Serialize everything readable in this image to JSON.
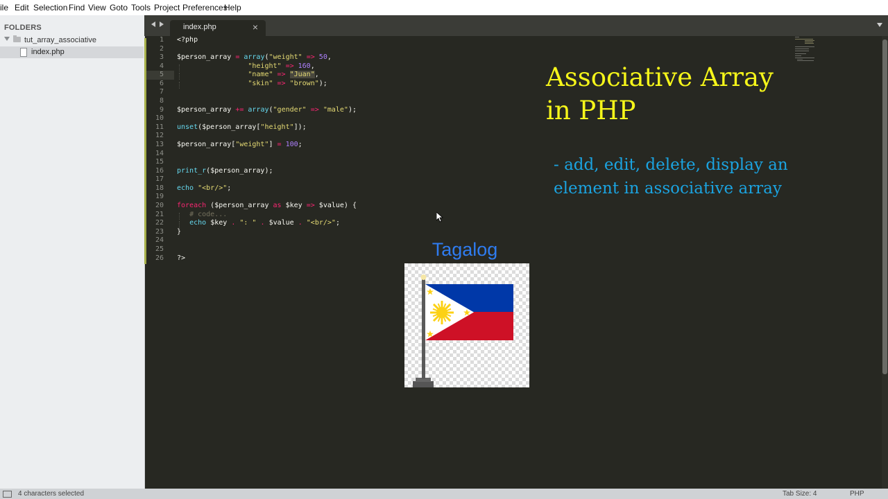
{
  "menubar": {
    "items": [
      "ile",
      "Edit",
      "Selection",
      "Find",
      "View",
      "Goto",
      "Tools",
      "Project",
      "Preferences",
      "Help"
    ]
  },
  "sidebar": {
    "heading": "FOLDERS",
    "folder": "tut_array_associative",
    "file": "index.php"
  },
  "tab": {
    "label": "index.php",
    "close": "×"
  },
  "editor": {
    "line_numbers": [
      "1",
      "2",
      "3",
      "4",
      "5",
      "6",
      "7",
      "8",
      "9",
      "10",
      "11",
      "12",
      "13",
      "14",
      "15",
      "16",
      "17",
      "18",
      "19",
      "20",
      "21",
      "22",
      "23",
      "24",
      "25",
      "26"
    ],
    "code": {
      "l1": "<?php",
      "l3_var": "$person_array",
      "l3_op": "=",
      "l3_fn": "array",
      "l3_key": "\"weight\"",
      "l3_arrow": "=>",
      "l3_val": "50",
      "l4_key": "\"height\"",
      "l4_val": "160",
      "l5_key": "\"name\"",
      "l5_val": "\"Juan\"",
      "l6_key": "\"skin\"",
      "l6_val": "\"brown\"",
      "l9_var": "$person_array",
      "l9_op": "+=",
      "l9_fn": "array",
      "l9_key": "\"gender\"",
      "l9_val": "\"male\"",
      "l11_fn": "unset",
      "l11_var": "$person_array",
      "l11_key": "\"height\"",
      "l13_var": "$person_array",
      "l13_key": "\"weight\"",
      "l13_op": "=",
      "l13_val": "100",
      "l16_fn": "print_r",
      "l16_var": "$person_array",
      "l18_kw": "echo",
      "l18_str": "\"<br/>\"",
      "l20_kw": "foreach",
      "l20_var": "$person_array",
      "l20_as": "as",
      "l20_key": "$key",
      "l20_arrow": "=>",
      "l20_value": "$value",
      "l21_cmt": "# code...",
      "l22_kw": "echo",
      "l22_key": "$key",
      "l22_dot": ".",
      "l22_sep": "\": \"",
      "l22_value": "$value",
      "l22_br": "\"<br/>\"",
      "l23": "}",
      "l26": "?>"
    }
  },
  "overlay": {
    "title_line1": "Associative Array",
    "title_line2": "in PHP",
    "subtitle_line1": "- add, edit, delete, display an",
    "subtitle_line2": "element in associative array",
    "language": "Tagalog"
  },
  "statusbar": {
    "selection": "4 characters selected",
    "tab_size": "Tab Size: 4",
    "syntax": "PHP"
  },
  "colors": {
    "editor_bg": "#272822",
    "title_yellow": "#f5f51a",
    "subtitle_blue": "#1ba3e0",
    "language_blue": "#2f7cf0",
    "flag_blue": "#0038a8",
    "flag_red": "#ce1126",
    "flag_yellow": "#fcd116"
  },
  "icons": {
    "flag": "philippines-flag-icon"
  }
}
